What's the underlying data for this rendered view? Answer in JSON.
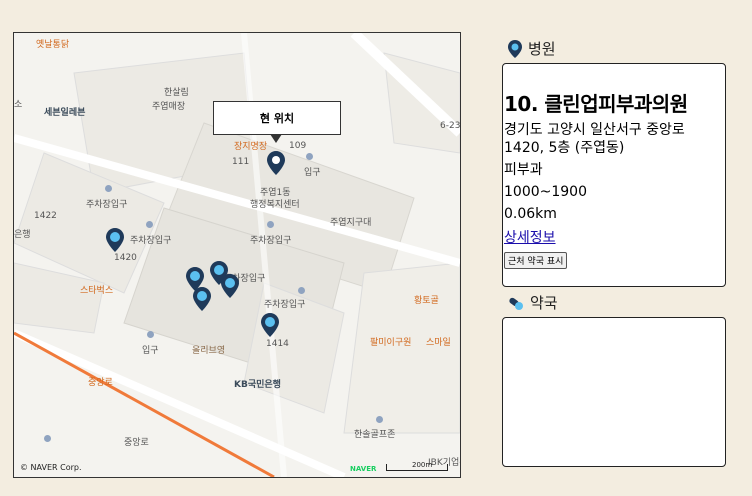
{
  "map": {
    "callout": "현 위치",
    "copyright": "© NAVER Corp.",
    "naver_logo": "NAVER",
    "scale": "200m",
    "labels": {
      "top_left": "옛날통닭",
      "hanaro": "한살림",
      "hanaro2": "주엽매장",
      "seven": "세븐일레븐",
      "jangji": "장지명장",
      "num111": "111",
      "num109": "109",
      "ipgu1": "입구",
      "office1": "주엽1동",
      "office2": "행정복지센터",
      "police": "주엽지구대",
      "parking1": "주차장입구",
      "parking2": "주차장입구",
      "parking3": "주차장입구",
      "parking4": "주차장입구",
      "parking5": "주차장입구",
      "num1422": "1422",
      "num1420": "1420",
      "bank1": "은행",
      "starbucks": "스타벅스",
      "ipgu2": "입구",
      "olive": "올리브영",
      "kb": "KB국민은행",
      "num1414": "1414",
      "hwangto": "황토골",
      "gim": "팔미이구원",
      "smile": "스마일",
      "golf": "한솔골프존",
      "ibk": "IBK기업은",
      "road": "중앙로",
      "road2": "중앙로",
      "so": "소",
      "cross": "6-23"
    }
  },
  "hospital": {
    "title": "병원",
    "name": "10. 클린업피부과의원",
    "address": "경기도 고양시 일산서구 중앙로 1420, 5층 (주엽동)",
    "dept": "피부과",
    "hours": "1000~1900",
    "distance": "0.06km",
    "detail_link": "상세정보",
    "pharmacy_button": "근처 약국 표시"
  },
  "pharmacy": {
    "title": "약국"
  },
  "colors": {
    "marker": "#1f3a5a",
    "road": "#f07a3a",
    "background": "#f3ede0"
  }
}
